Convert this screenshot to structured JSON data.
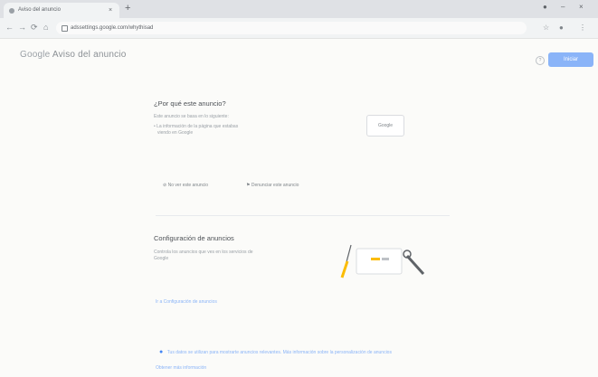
{
  "browser": {
    "tab_title": "Aviso del anuncio",
    "tab_close": "×",
    "new_tab": "+",
    "window_min": "–",
    "window_close": "×",
    "url": "adssettings.google.com/whythisad",
    "nav": {
      "back": "←",
      "forward": "→",
      "reload": "⟳",
      "home": "⌂"
    },
    "right_icons": {
      "ext": "☆",
      "profile": "●",
      "menu": "⋮"
    }
  },
  "app": {
    "logo_prefix": "Google",
    "logo_title": "Aviso del anuncio",
    "help_label": "?",
    "signin_label": "Iniciar"
  },
  "why_section": {
    "heading": "¿Por qué este anuncio?",
    "line1": "Este anuncio se basa en lo siguiente:",
    "line2": "• La información de la página que estabas",
    "line3": "viendo en Google",
    "box_label": "Google",
    "action1": "No ver este anuncio",
    "action2": "Denunciar este anuncio"
  },
  "settings_section": {
    "heading": "Configuración de anuncios",
    "desc1": "Controla los anuncios que ves en los servicios de",
    "desc2": "Google",
    "link": "Ir a Configuración de anuncios"
  },
  "footer": {
    "info": "Tus datos se utilizan para mostrarte anuncios relevantes. Más información sobre la personalización de anuncios",
    "link2": "Obtener más información"
  }
}
